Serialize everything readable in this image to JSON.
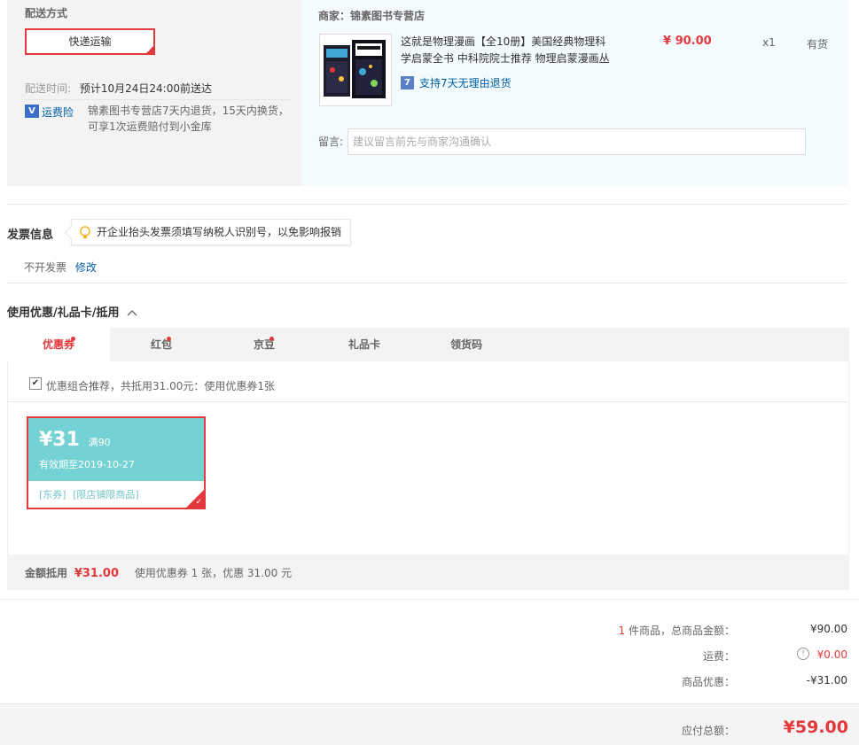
{
  "shipping": {
    "title": "配送方式",
    "method_label": "快递运输",
    "time_label": "配送时间:",
    "time_value": "预计10月24日24:00前送达",
    "insurance_badge": "V",
    "insurance_label": "运费险",
    "insurance_desc": "锦素图书专营店7天内退货，15天内换货，可享1次运费赔付到小金库"
  },
  "shop": {
    "merchant_label": "商家：锦素图书专营店",
    "product_title": "这就是物理漫画【全10册】美国经典物理科学启蒙全书 中科院院士推荐 物理启蒙漫画丛",
    "price": "¥ 90.00",
    "qty": "x1",
    "stock": "有货",
    "return_badge": "7",
    "return_text": "支持7天无理由退货",
    "message_label": "留言:",
    "message_placeholder": "建议留言前先与商家沟通确认"
  },
  "invoice": {
    "title": "发票信息",
    "tip": "开企业抬头发票须填写纳税人识别号，以免影响报销",
    "status": "不开发票",
    "edit": "修改"
  },
  "discount": {
    "title": "使用优惠/礼品卡/抵用",
    "toggle_icon": "chevron-up-icon",
    "tabs": [
      {
        "label": "优惠券"
      },
      {
        "label": "红包"
      },
      {
        "label": "京豆"
      },
      {
        "label": "礼品卡"
      },
      {
        "label": "领货码"
      }
    ],
    "recommend_text": "优惠组合推荐，共抵用31.00元：使用优惠券1张",
    "coupon": {
      "amount": "¥31",
      "condition": "满90",
      "valid": "有效期至2019-10-27",
      "tag1": "[东券]",
      "tag2": "[限店铺限商品]"
    },
    "summary_label": "金额抵用",
    "summary_amount": "¥31.00",
    "summary_desc": "使用优惠券 1 张，优惠 31.00 元"
  },
  "totals": {
    "count": "1",
    "count_label": "件商品，总商品金额：",
    "goods_amount": "¥90.00",
    "freight_label": "运费：",
    "freight": "¥0.00",
    "discount_label": "商品优惠：",
    "discount": "-¥31.00",
    "payable_label": "应付总额：",
    "payable": "¥59.00"
  },
  "colors": {
    "accent": "#e4393c",
    "coupon": "#74d2d4",
    "link": "#005ea7"
  }
}
